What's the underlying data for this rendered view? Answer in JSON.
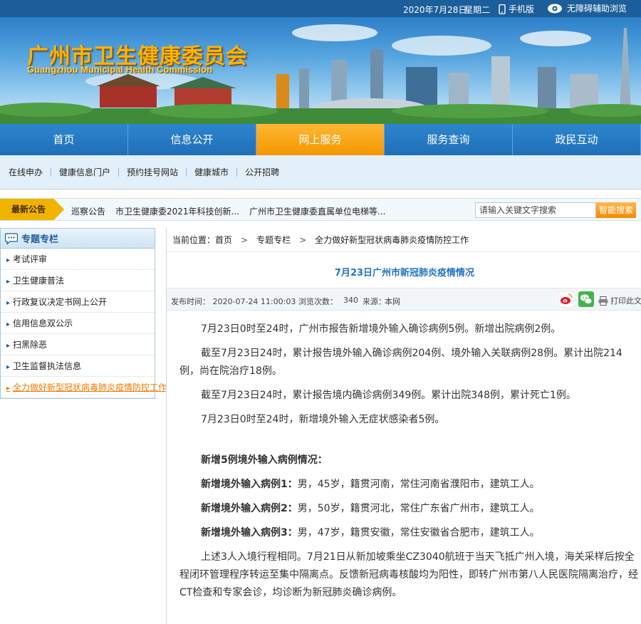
{
  "topbar": {
    "date": "2020年7月28日",
    "weekday": "星期二",
    "mobile_label": "手机版",
    "accessibility_label": "无障碍辅助浏览"
  },
  "banner": {
    "title_cn": "广州市卫生健康委员会",
    "title_en": "Guangzhou Municipal Health Commission"
  },
  "nav": {
    "items": [
      {
        "label": "首页"
      },
      {
        "label": "信息公开"
      },
      {
        "label": "网上服务"
      },
      {
        "label": "服务查询"
      },
      {
        "label": "政民互动"
      }
    ],
    "active_index": 2
  },
  "subnav": {
    "items": [
      {
        "label": "在线申办"
      },
      {
        "label": "健康信息门户"
      },
      {
        "label": "预约挂号网站"
      },
      {
        "label": "健康城市"
      },
      {
        "label": "公开招聘"
      }
    ]
  },
  "notice": {
    "label": "最新公告",
    "items": [
      {
        "text": "巡察公告"
      },
      {
        "text": "市卫生健康委2021年科技创新..."
      },
      {
        "text": "广州市卫生健康委直属单位电梯等..."
      }
    ],
    "search_placeholder": "请输入关键文字搜索",
    "search_button": "智能搜索"
  },
  "sidebar": {
    "title": "专题专栏",
    "items": [
      {
        "label": "考试评审"
      },
      {
        "label": "卫生健康普法"
      },
      {
        "label": "行政复议决定书网上公开"
      },
      {
        "label": "信用信息双公示"
      },
      {
        "label": "扫黑除恶"
      },
      {
        "label": "卫生监督执法信息"
      },
      {
        "label": "全力做好新型冠状病毒肺炎疫情防控工作"
      }
    ],
    "active_index": 6
  },
  "breadcrumb": {
    "prefix": "当前位置：",
    "items": [
      {
        "label": "首页"
      },
      {
        "label": "专题专栏"
      },
      {
        "label": "全力做好新型冠状病毒肺炎疫情防控工作"
      }
    ]
  },
  "article": {
    "title": "7月23日广州市新冠肺炎疫情情况",
    "meta": {
      "publish_label": "发布时间：",
      "publish_time": "2020-07-24 11:00:03",
      "views_label": "浏览次数：",
      "views": "340",
      "source_label": "来源：",
      "source": "本网",
      "print_label": "打印此文"
    },
    "paragraphs": [
      "7月23日0时至24时，广州市报告新增境外输入确诊病例5例。新增出院病例2例。",
      "截至7月23日24时，累计报告境外输入确诊病例204例、境外输入关联病例28例。累计出院214例，尚在院治疗18例。",
      "截至7月23日24时，累计报告境内确诊病例349例。累计出院348例，累计死亡1例。",
      "7月23日0时至24时，新增境外输入无症状感染者5例。"
    ],
    "section_title": "新增5例境外输入病例情况：",
    "cases": [
      {
        "label": "新增境外输入病例1：",
        "text": "男，45岁，籍贯河南，常住河南省濮阳市，建筑工人。"
      },
      {
        "label": "新增境外输入病例2：",
        "text": "男，50岁，籍贯河北，常住广东省广州市，建筑工人。"
      },
      {
        "label": "新增境外输入病例3：",
        "text": "男，47岁，籍贯安徽，常住安徽省合肥市，建筑工人。"
      }
    ],
    "closing": "上述3人入境行程相同。7月21日从新加坡乘坐CZ3040航班于当天飞抵广州入境，海关采样后按全程闭环管理程序转运至集中隔离点。反馈新冠病毒核酸均为阳性，即转广州市第八人民医院隔离治疗，经CT检查和专家会诊，均诊断为新冠肺炎确诊病例。"
  }
}
